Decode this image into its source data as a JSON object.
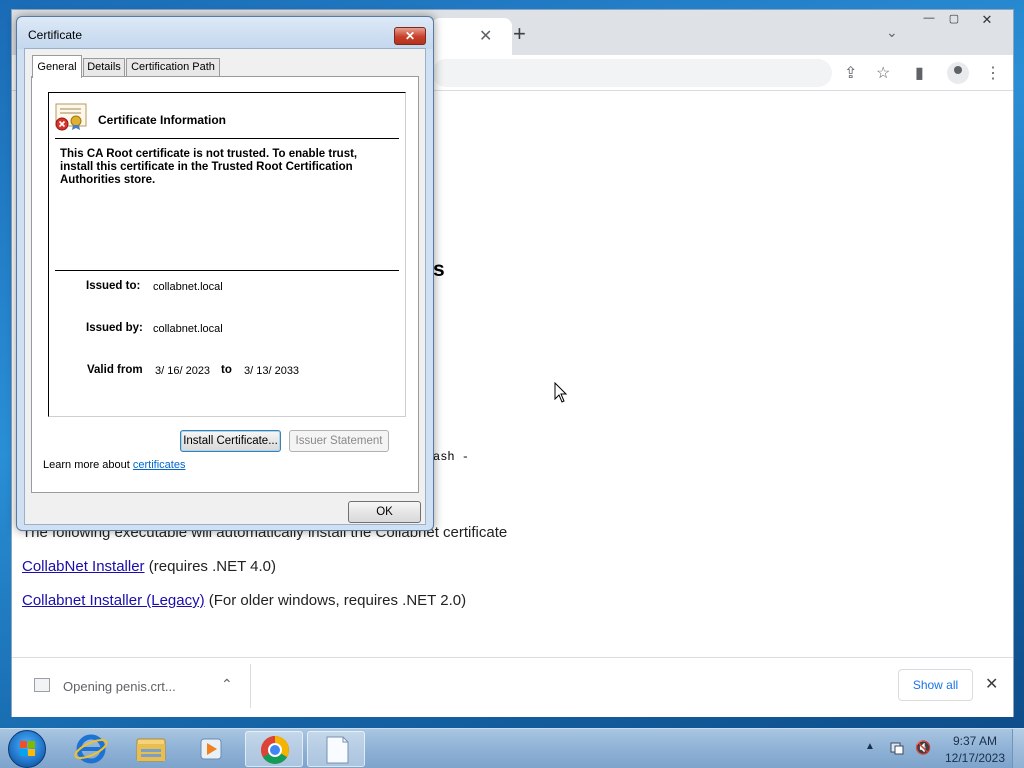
{
  "browser": {
    "tab_close": "✕",
    "new_tab": "+",
    "tab_dropdown": "⌄",
    "window_minimize": "—",
    "window_restore": "▢",
    "window_close": "✕",
    "toolbar": {
      "share": "⇪",
      "bookmark": "☆",
      "side_panel": "▮",
      "menu": "⋮"
    },
    "page": {
      "heading_fragment": "s",
      "code_fragment": "ash -",
      "line1": "The following executable will automatically install the Collabnet certificate",
      "line2_link": "CollabNet Installer",
      "line2_rest": " (requires .NET 4.0)",
      "line3_link": "Collabnet Installer (Legacy)",
      "line3_rest": " (For older windows, requires .NET 2.0)"
    },
    "download_bar": {
      "item_text": "Opening penis.crt...",
      "chevron": "⌃",
      "show_all": "Show all",
      "close": "✕"
    }
  },
  "dialog": {
    "title": "Certificate",
    "close": "✕",
    "tabs": [
      "General",
      "Details",
      "Certification Path"
    ],
    "info_heading": "Certificate Information",
    "message": "This CA Root certificate is not trusted. To enable trust, install this certificate in the Trusted Root Certification Authorities store.",
    "issued_to_label": "Issued to:",
    "issued_to": "collabnet.local",
    "issued_by_label": "Issued by:",
    "issued_by": "collabnet.local",
    "valid_from_label": "Valid from",
    "valid_from": "3/ 16/ 2023",
    "to_label": "to",
    "valid_to": "3/ 13/ 2033",
    "install_button": "Install Certificate...",
    "issuer_button": "Issuer Statement",
    "learn_prefix": "Learn more about ",
    "learn_link": "certificates",
    "ok_button": "OK"
  },
  "taskbar": {
    "tray_arrow": "▲",
    "tray_sound": "🔇",
    "time": "9:37 AM",
    "date": "12/17/2023"
  },
  "colors": {
    "link": "#1a0dab",
    "accent": "#1a73e8",
    "close_red": "#c7402a"
  }
}
